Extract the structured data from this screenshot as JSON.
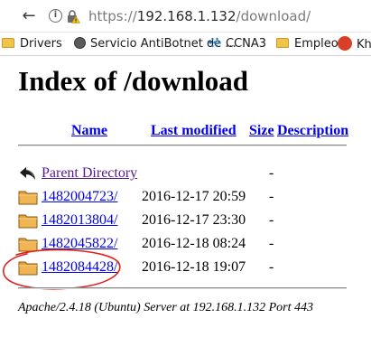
{
  "browser": {
    "url": {
      "scheme": "https://",
      "host": "192.168.1.132",
      "path": "/download/"
    },
    "bookmarks": [
      {
        "label": "Drivers",
        "icon": "folder-icon"
      },
      {
        "label": "Servicio AntiBotnet de ...",
        "icon": "globe-icon"
      },
      {
        "label": "CCNA3",
        "icon": "dots-icon"
      },
      {
        "label": "Empleo",
        "icon": "folder-icon"
      },
      {
        "label": "Kha",
        "icon": "monster-icon"
      }
    ]
  },
  "page": {
    "title": "Index of /download",
    "columns": {
      "name": "Name",
      "last_modified": "Last modified",
      "size": "Size",
      "description": "Description"
    },
    "parent": {
      "label": "Parent Directory",
      "size": "-",
      "icon": "back-arrow-icon"
    },
    "entries": [
      {
        "name": "1482004723/",
        "modified": "2016-12-17 20:59",
        "size": "-",
        "icon": "folder-icon"
      },
      {
        "name": "1482013804/",
        "modified": "2016-12-17 23:30",
        "size": "-",
        "icon": "folder-icon"
      },
      {
        "name": "1482045822/",
        "modified": "2016-12-18 08:24",
        "size": "-",
        "icon": "folder-icon"
      },
      {
        "name": "1482084428/",
        "modified": "2016-12-18 19:07",
        "size": "-",
        "icon": "folder-icon"
      }
    ],
    "address": "Apache/2.4.18 (Ubuntu) Server at 192.168.1.132 Port 443"
  },
  "colors": {
    "link": "#0000ee",
    "visited": "#551a8b",
    "annotation": "#e0201c"
  }
}
